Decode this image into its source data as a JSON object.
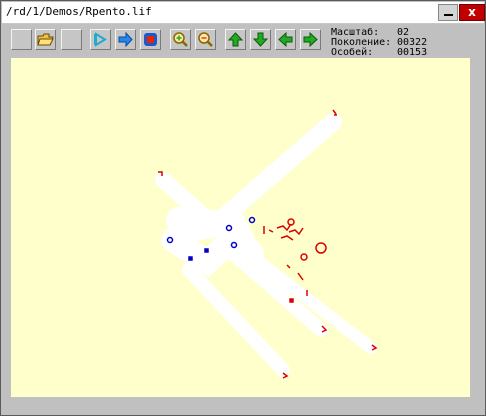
{
  "window": {
    "title": "/rd/1/Demos/Rpento.lif",
    "minimize_label": "",
    "close_label": "x"
  },
  "toolbar": {
    "buttons": [
      {
        "icon": "blank-icon"
      },
      {
        "icon": "open-folder-icon"
      },
      {
        "icon": "blank-icon"
      },
      {
        "icon": "step-icon"
      },
      {
        "icon": "arrow-right-icon"
      },
      {
        "icon": "stop-icon"
      },
      {
        "icon": "zoom-in-icon"
      },
      {
        "icon": "zoom-out-icon"
      },
      {
        "icon": "arrow-up-icon"
      },
      {
        "icon": "arrow-down-icon"
      },
      {
        "icon": "arrow-left-icon"
      },
      {
        "icon": "arrow-right-green-icon"
      }
    ]
  },
  "stats": {
    "scale_label": "Масштаб:",
    "scale_value": "02",
    "generation_label": "Поколение:",
    "generation_value": "00322",
    "population_label": "Особей:",
    "population_value": "00153"
  },
  "colors": {
    "canvas_bg": "#ffffcc",
    "trail": "#ffffff",
    "cell_old": "#0000cc",
    "cell_new": "#dd0000",
    "accent_green": "#22aa22",
    "accent_blue": "#2288ee",
    "close_red": "#c00000"
  }
}
